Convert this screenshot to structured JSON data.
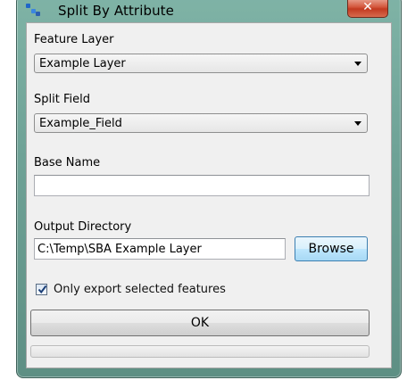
{
  "window": {
    "title": "Split By Attribute",
    "close_label": "✕"
  },
  "form": {
    "feature_layer": {
      "label": "Feature Layer",
      "value": "Example Layer"
    },
    "split_field": {
      "label": "Split Field",
      "value": "Example_Field"
    },
    "base_name": {
      "label": "Base Name",
      "value": ""
    },
    "output_directory": {
      "label": "Output Directory",
      "value": "C:\\Temp\\SBA Example Layer",
      "browse_label": "Browse"
    },
    "only_selected": {
      "label": "Only export selected features",
      "checked": true
    },
    "ok_label": "OK",
    "progress": 0
  },
  "colors": {
    "frame": "#6fa397",
    "close_button": "#c23a20",
    "client_background": "#f0f0f0"
  }
}
